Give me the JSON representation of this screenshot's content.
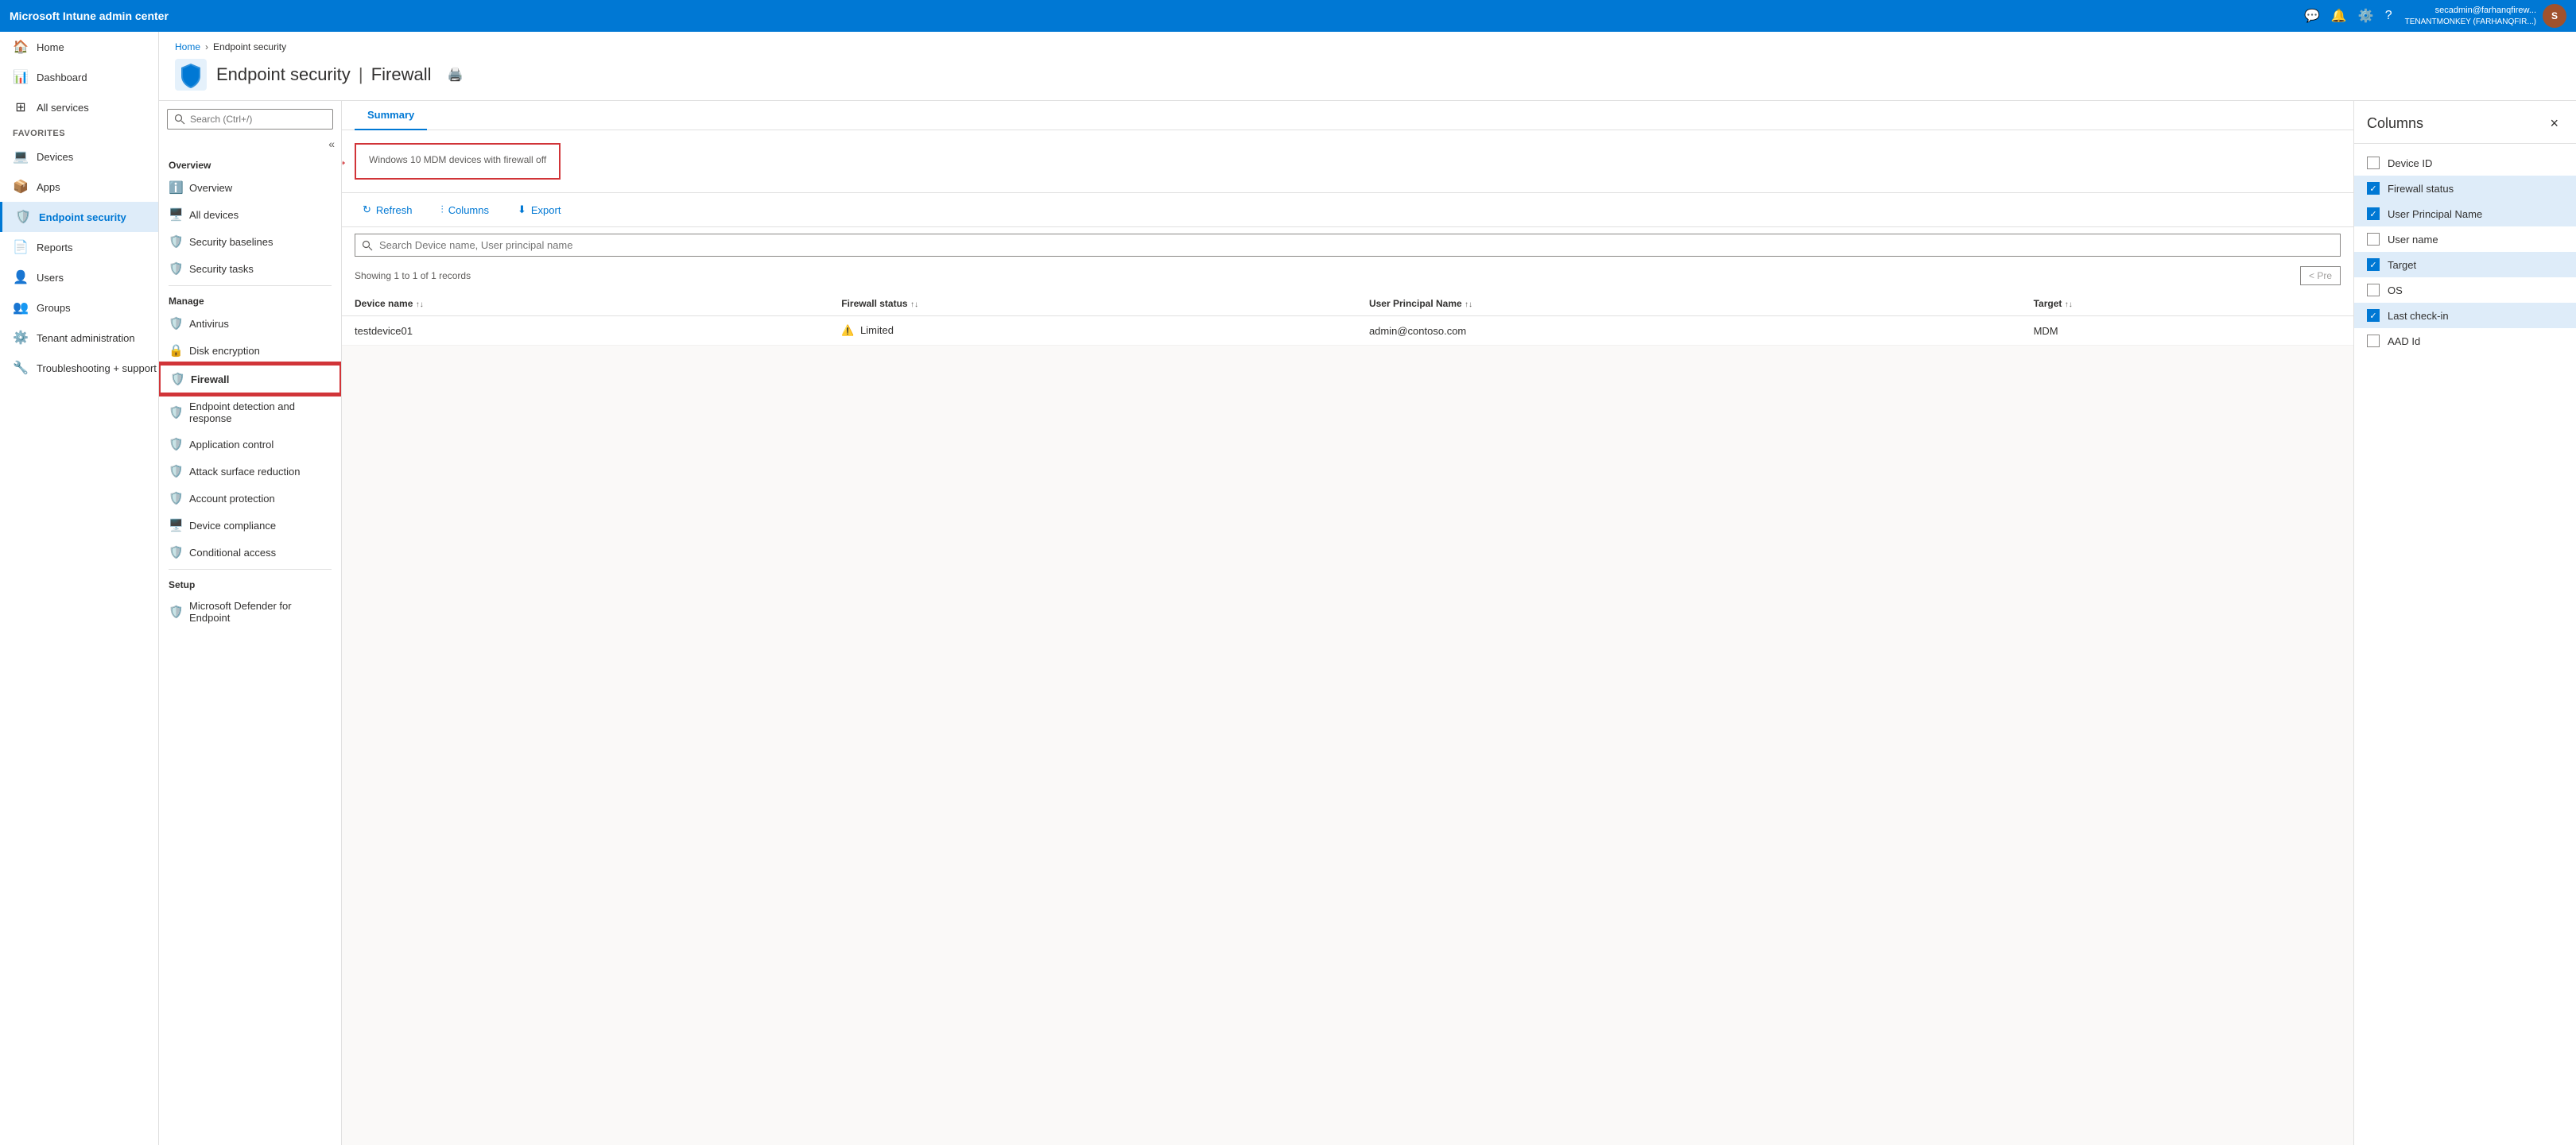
{
  "topbar": {
    "title": "Microsoft Intune admin center",
    "user_name": "secadmin@farhanqfirew...",
    "user_tenant": "TENANTMONKEY (FARHANQFIR...)",
    "user_initials": "S"
  },
  "sidebar": {
    "items": [
      {
        "id": "home",
        "label": "Home",
        "icon": "🏠"
      },
      {
        "id": "dashboard",
        "label": "Dashboard",
        "icon": "📊"
      },
      {
        "id": "all-services",
        "label": "All services",
        "icon": "⊞"
      },
      {
        "id": "favorites-section",
        "label": "FAVORITES",
        "type": "section"
      },
      {
        "id": "devices",
        "label": "Devices",
        "icon": "💻"
      },
      {
        "id": "apps",
        "label": "Apps",
        "icon": "📦"
      },
      {
        "id": "endpoint-security",
        "label": "Endpoint security",
        "icon": "🛡️",
        "active": true
      },
      {
        "id": "reports",
        "label": "Reports",
        "icon": "📄"
      },
      {
        "id": "users",
        "label": "Users",
        "icon": "👤"
      },
      {
        "id": "groups",
        "label": "Groups",
        "icon": "👥"
      },
      {
        "id": "tenant-admin",
        "label": "Tenant administration",
        "icon": "⚙️"
      },
      {
        "id": "troubleshooting",
        "label": "Troubleshooting + support",
        "icon": "🔧"
      }
    ]
  },
  "breadcrumb": {
    "home": "Home",
    "section": "Endpoint security"
  },
  "page": {
    "title": "Endpoint security",
    "separator": "|",
    "subtitle": "Firewall",
    "print_tooltip": "Print"
  },
  "sub_nav": {
    "search_placeholder": "Search (Ctrl+/)",
    "overview_section": "Overview",
    "overview_items": [
      {
        "id": "overview",
        "label": "Overview",
        "icon": "ℹ️"
      },
      {
        "id": "all-devices",
        "label": "All devices",
        "icon": "🖥️"
      },
      {
        "id": "security-baselines",
        "label": "Security baselines",
        "icon": "🛡️"
      },
      {
        "id": "security-tasks",
        "label": "Security tasks",
        "icon": "🛡️"
      }
    ],
    "manage_section": "Manage",
    "manage_items": [
      {
        "id": "antivirus",
        "label": "Antivirus",
        "icon": "🛡️"
      },
      {
        "id": "disk-encryption",
        "label": "Disk encryption",
        "icon": "🔒"
      },
      {
        "id": "firewall",
        "label": "Firewall",
        "icon": "🛡️",
        "active": true,
        "highlighted": true
      },
      {
        "id": "endpoint-detection",
        "label": "Endpoint detection and response",
        "icon": "🛡️"
      },
      {
        "id": "application-control",
        "label": "Application control",
        "icon": "🛡️"
      },
      {
        "id": "attack-surface",
        "label": "Attack surface reduction",
        "icon": "🛡️"
      },
      {
        "id": "account-protection",
        "label": "Account protection",
        "icon": "🛡️"
      },
      {
        "id": "device-compliance",
        "label": "Device compliance",
        "icon": "🖥️"
      },
      {
        "id": "conditional-access",
        "label": "Conditional access",
        "icon": "🛡️"
      }
    ],
    "setup_section": "Setup",
    "setup_items": [
      {
        "id": "ms-defender",
        "label": "Microsoft Defender for Endpoint",
        "icon": "🛡️"
      }
    ]
  },
  "summary_tabs": [
    {
      "id": "summary",
      "label": "Summary",
      "active": true
    }
  ],
  "firewall_card": {
    "label": "Windows 10 MDM devices with firewall off",
    "selected": true
  },
  "toolbar": {
    "refresh_label": "Refresh",
    "columns_label": "Columns",
    "export_label": "Export"
  },
  "search": {
    "placeholder": "Search Device name, User principal name"
  },
  "records": {
    "text": "Showing 1 to 1 of 1 records"
  },
  "table": {
    "columns": [
      {
        "id": "device-name",
        "label": "Device name",
        "sortable": true
      },
      {
        "id": "firewall-status",
        "label": "Firewall status",
        "sortable": true
      },
      {
        "id": "upn",
        "label": "User Principal Name",
        "sortable": true
      },
      {
        "id": "target",
        "label": "Target",
        "sortable": true
      }
    ],
    "rows": [
      {
        "device_name": "testdevice01",
        "firewall_status": "Limited",
        "firewall_status_warning": true,
        "upn": "admin@contoso.com",
        "target": "MDM"
      }
    ]
  },
  "pagination": {
    "prev_label": "< Pre"
  },
  "columns_panel": {
    "title": "Columns",
    "close_label": "×",
    "items": [
      {
        "id": "device-id",
        "label": "Device ID",
        "checked": false
      },
      {
        "id": "firewall-status",
        "label": "Firewall status",
        "checked": true
      },
      {
        "id": "upn",
        "label": "User Principal Name",
        "checked": true
      },
      {
        "id": "user-name",
        "label": "User name",
        "checked": false
      },
      {
        "id": "target",
        "label": "Target",
        "checked": true
      },
      {
        "id": "os",
        "label": "OS",
        "checked": false
      },
      {
        "id": "last-checkin",
        "label": "Last check-in",
        "checked": true
      },
      {
        "id": "aad-id",
        "label": "AAD Id",
        "checked": false
      }
    ]
  }
}
